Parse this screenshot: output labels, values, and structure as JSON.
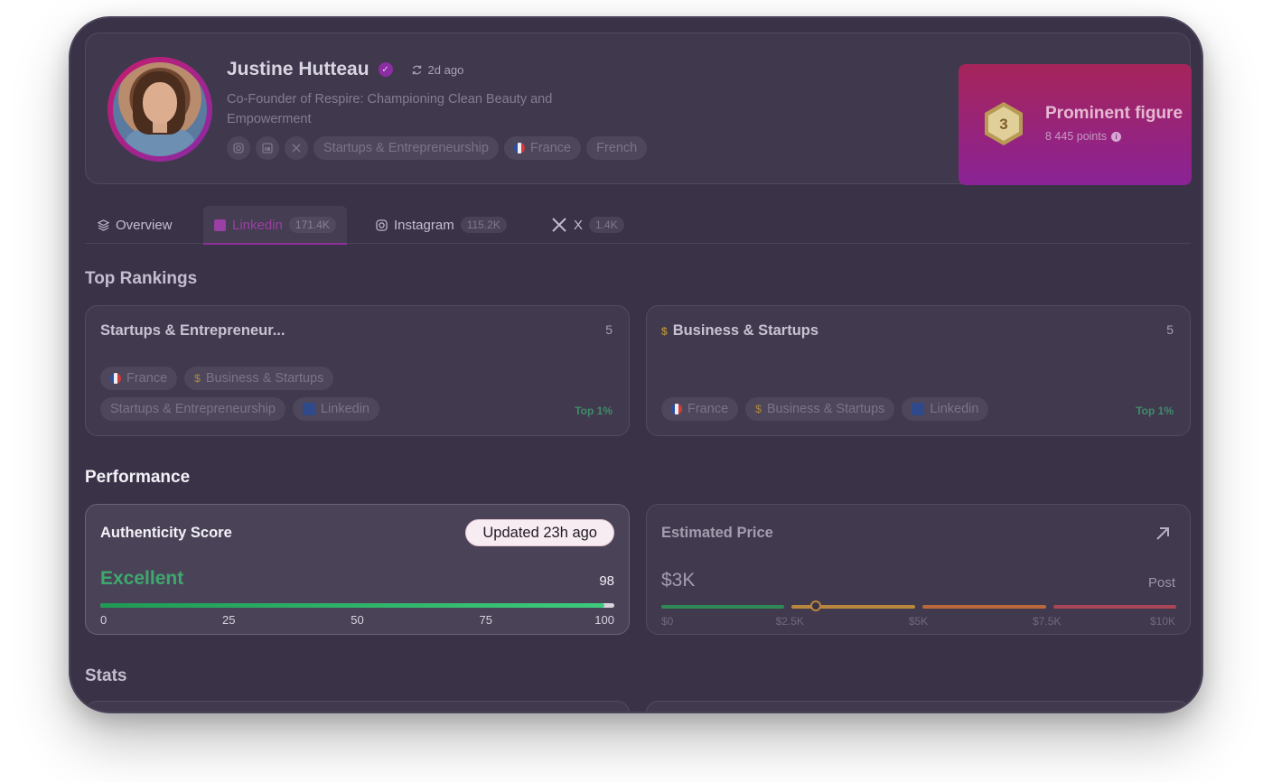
{
  "profile": {
    "name": "Justine Hutteau",
    "updated": "2d ago",
    "bio": "Co-Founder of Respire: Championing Clean Beauty and Empowerment",
    "social_icons": [
      "instagram-icon",
      "linkedin-icon",
      "x-icon"
    ],
    "tags": [
      "Startups & Entrepreneurship",
      "France",
      "French"
    ]
  },
  "rank_badge": {
    "level": "3",
    "title": "Prominent figure",
    "points": "8 445 points"
  },
  "tabs": [
    {
      "label": "Overview",
      "count": "",
      "icon": "layers-icon"
    },
    {
      "label": "Linkedin",
      "count": "171.4K",
      "icon": "linkedin-icon"
    },
    {
      "label": "Instagram",
      "count": "115.2K",
      "icon": "instagram-icon"
    },
    {
      "label": "X",
      "count": "1.4K",
      "icon": "x-icon"
    }
  ],
  "sections": {
    "top_rankings": "Top Rankings",
    "performance": "Performance",
    "stats": "Stats"
  },
  "rankings": [
    {
      "title": "Startups & Entrepreneur...",
      "count": "5",
      "chips_row1": [
        "France",
        "Business & Startups"
      ],
      "chips_row2": [
        "Startups & Entrepreneurship",
        "Linkedin"
      ],
      "top": "Top 1%"
    },
    {
      "title": "Business & Startups",
      "count": "5",
      "chips_row1": [
        "France",
        "Business & Startups",
        "Linkedin"
      ],
      "top": "Top 1%"
    }
  ],
  "authenticity": {
    "title": "Authenticity Score",
    "updated": "Updated 23h ago",
    "rating": "Excellent",
    "score": "98",
    "score_value": 98,
    "ticks": [
      "0",
      "25",
      "50",
      "75",
      "100"
    ]
  },
  "estimated_price": {
    "title": "Estimated Price",
    "price": "$3K",
    "unit": "Post",
    "price_value": 3000,
    "ticks": [
      "$0",
      "$2.5K",
      "$5K",
      "$7.5K",
      "$10K"
    ]
  },
  "colors": {
    "accent": "#8f2f9a",
    "success": "#3ea96d",
    "background": "#3a3347"
  }
}
